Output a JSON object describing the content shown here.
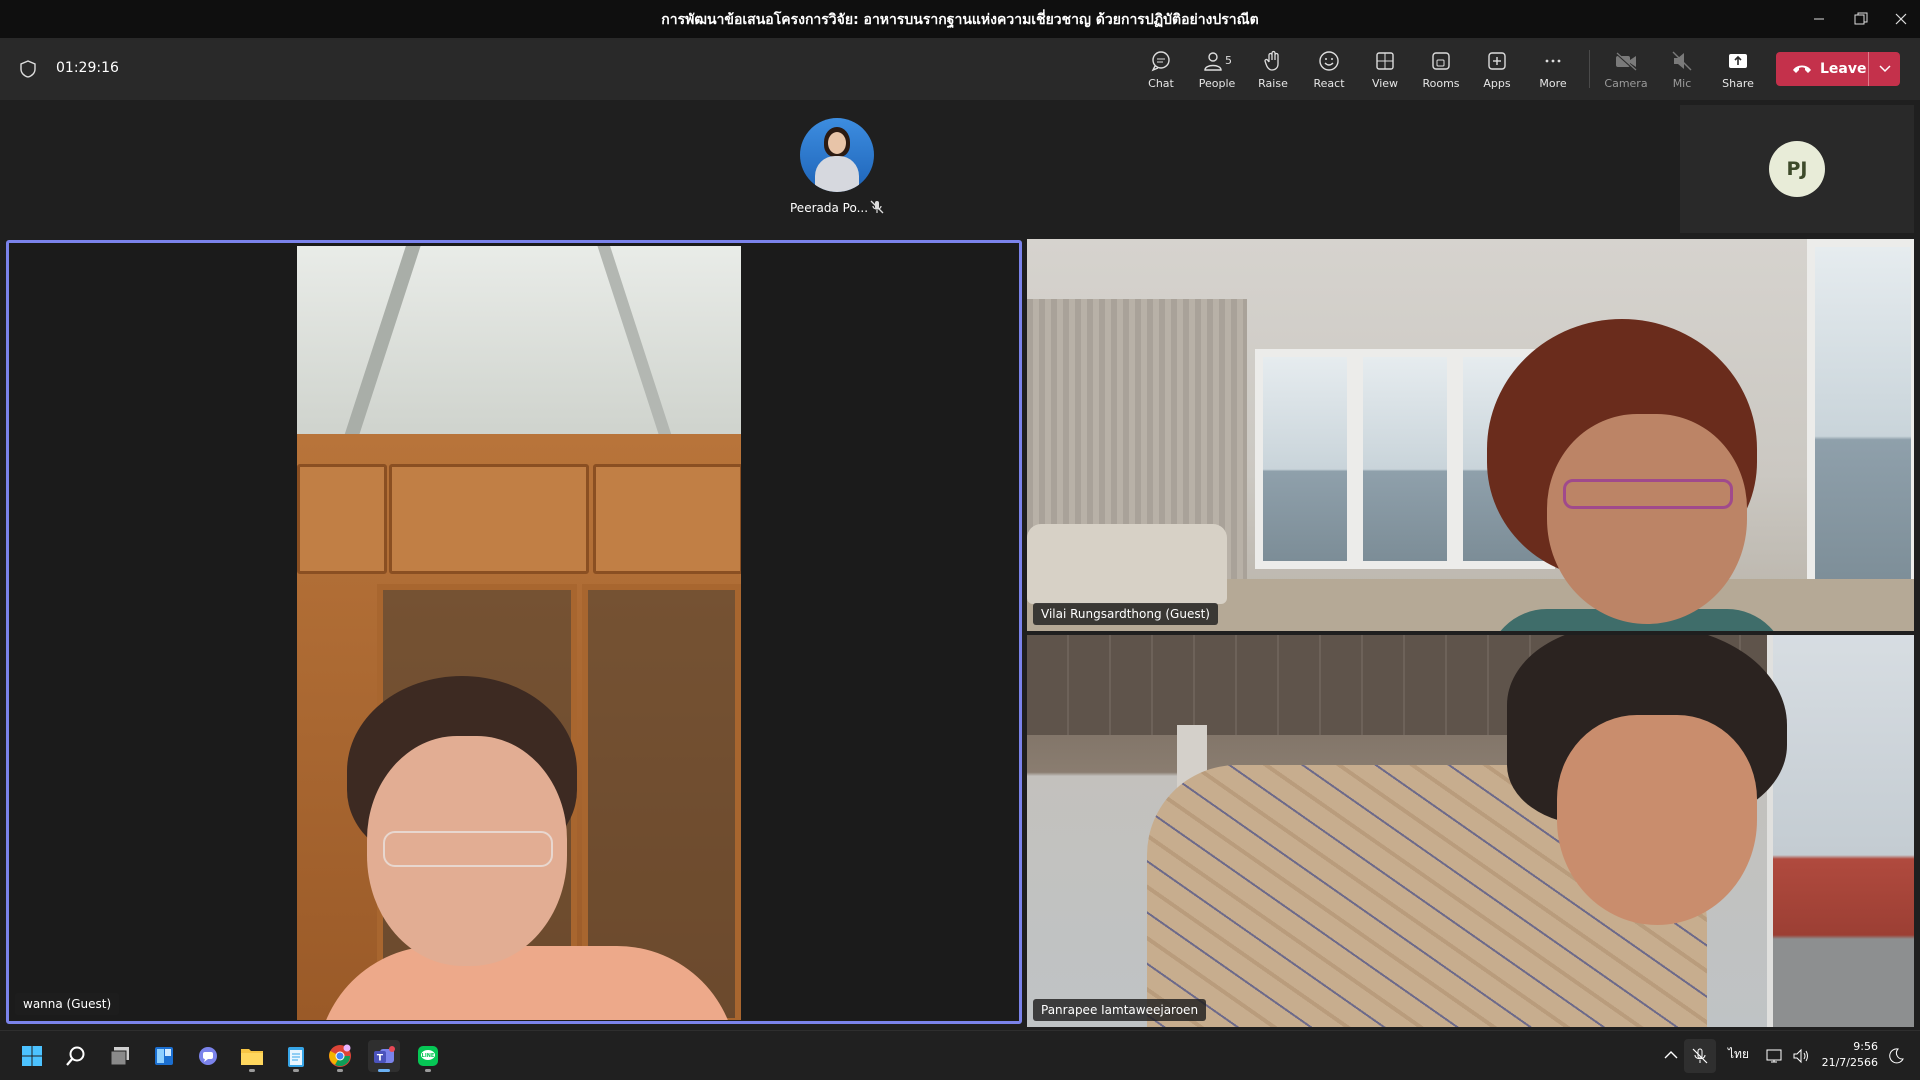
{
  "window": {
    "title": "การพัฒนาข้อเสนอโครงการวิจัย: อาหารบนรากฐานแห่งความเชี่ยวชาญ ด้วยการปฏิบัติอย่างปราณีต",
    "controls": [
      "minimize",
      "restore",
      "close"
    ]
  },
  "meeting": {
    "timer": "01:29:16",
    "toolbar": {
      "chat": "Chat",
      "people": "People",
      "people_count": "5",
      "raise": "Raise",
      "react": "React",
      "view": "View",
      "rooms": "Rooms",
      "apps": "Apps",
      "more": "More",
      "camera": "Camera",
      "mic": "Mic",
      "share": "Share",
      "leave": "Leave"
    },
    "colors": {
      "leave": "#c4314b",
      "active_border": "#7b83eb",
      "toolbar_bg": "#292929"
    }
  },
  "participants": {
    "top": {
      "name": "Peerada Po...",
      "muted": true
    },
    "pj": {
      "initials": "PJ"
    },
    "tiles": [
      {
        "name": "wanna (Guest)",
        "active": true
      },
      {
        "name": "Vilai Rungsardthong (Guest)",
        "active": false
      },
      {
        "name": "Panrapee Iamtaweejaroen",
        "active": false
      }
    ]
  },
  "taskbar": {
    "apps": [
      "start-icon",
      "search-icon",
      "task-view-icon",
      "widgets-icon",
      "teams-chat-icon",
      "file-explorer-icon",
      "notepad-icon",
      "chrome-icon",
      "teams-icon",
      "line-icon"
    ],
    "tray": {
      "language": "ไทย"
    },
    "clock": {
      "time": "9:56",
      "date": "21/7/2566"
    }
  }
}
